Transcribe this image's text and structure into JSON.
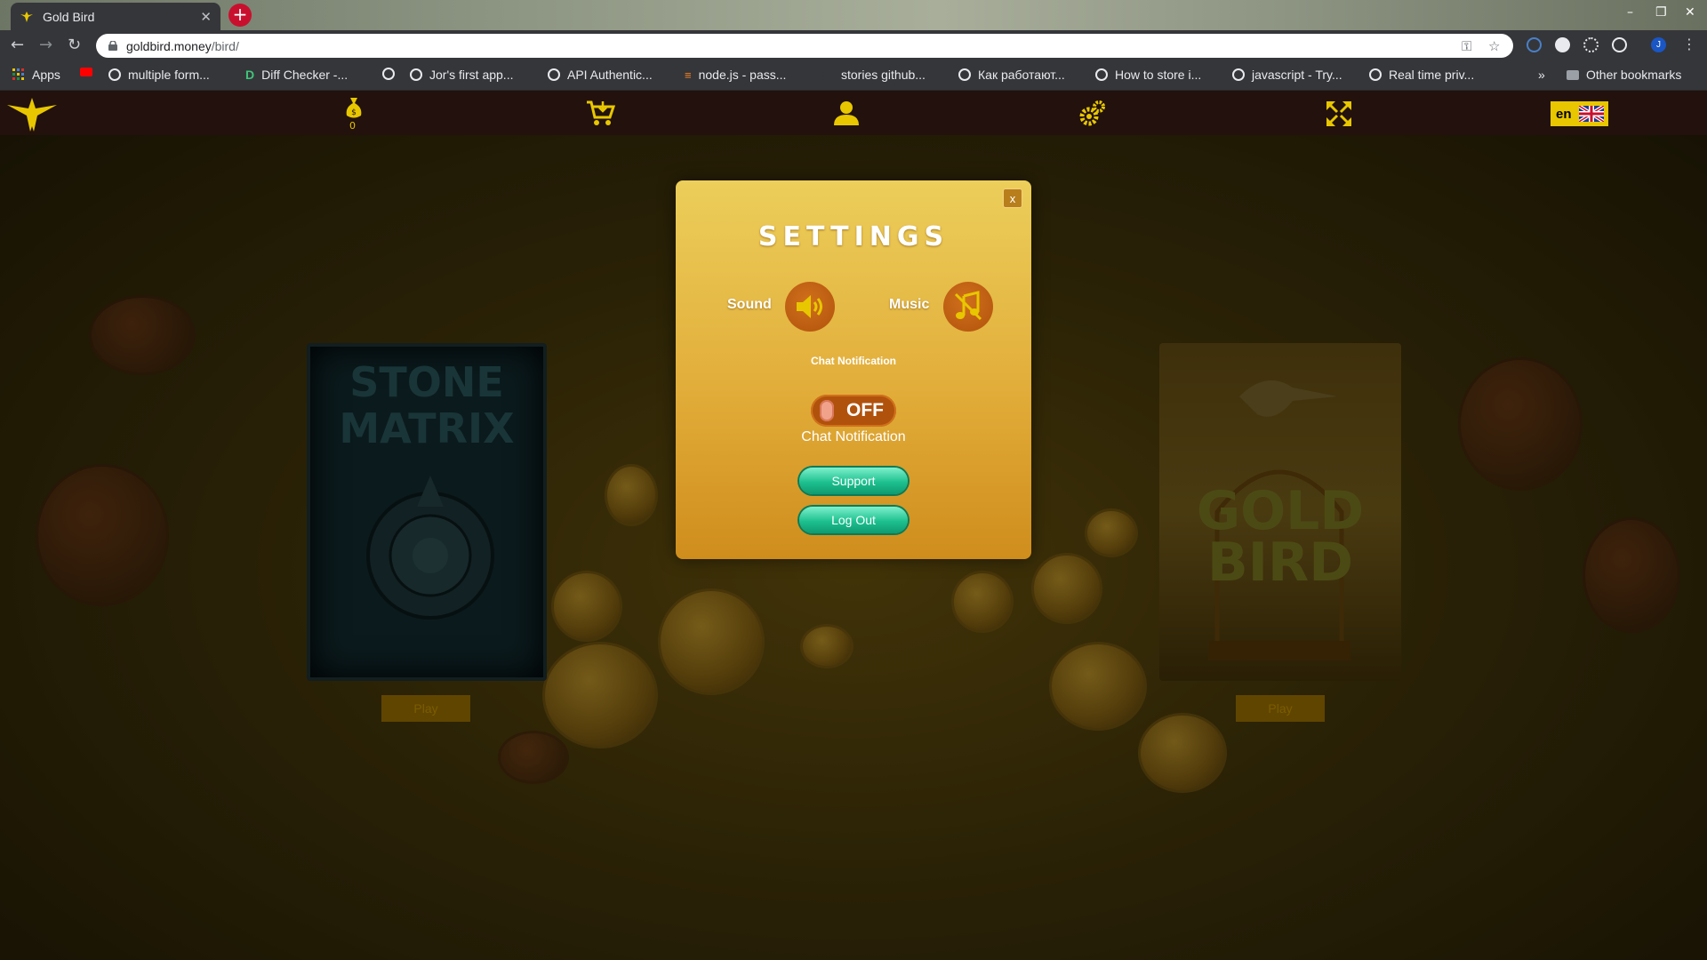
{
  "browser": {
    "tab_title": "Gold Bird",
    "url_host": "goldbird.money",
    "url_path": "/bird/",
    "bookmarks": [
      {
        "label": "Apps",
        "icon": "apps-grid-icon"
      },
      {
        "label": "",
        "icon": "youtube-icon"
      },
      {
        "label": "multiple form...",
        "icon": "globe-icon"
      },
      {
        "label": "Diff Checker -...",
        "icon": "diffchecker-icon"
      },
      {
        "label": "",
        "icon": "globe-icon"
      },
      {
        "label": "Jor's first app...",
        "icon": "globe-icon"
      },
      {
        "label": "API Authentic...",
        "icon": "globe-icon"
      },
      {
        "label": "node.js - pass...",
        "icon": "stackoverflow-icon"
      },
      {
        "label": "stories github...",
        "icon": "github-icon"
      },
      {
        "label": "Как работают...",
        "icon": "globe-icon"
      },
      {
        "label": "How to store i...",
        "icon": "globe-icon"
      },
      {
        "label": "javascript - Try...",
        "icon": "globe-icon"
      },
      {
        "label": "Real time priv...",
        "icon": "globe-icon"
      }
    ],
    "overflow_label": "»",
    "other_bookmarks": "Other bookmarks",
    "profile_initial": "J"
  },
  "game_nav": {
    "coins": "0",
    "language": "en"
  },
  "cards": [
    {
      "title": "STONE MATRIX",
      "play_label": "Play"
    },
    {
      "title": "GOLD BIRD",
      "play_label": "Play"
    }
  ],
  "settings": {
    "close_label": "x",
    "title": "SETTINGS",
    "sound_label": "Sound",
    "music_label": "Music",
    "chat_heading": "Chat Notification",
    "toggle_state": "OFF",
    "chat_sublabel": "Chat Notification",
    "support_label": "Support",
    "logout_label": "Log Out"
  },
  "colors": {
    "accent_gold": "#e8c700",
    "modal_gold": "#e2ad3a",
    "button_teal": "#1dc08f",
    "toggle_orange": "#b1520c"
  }
}
